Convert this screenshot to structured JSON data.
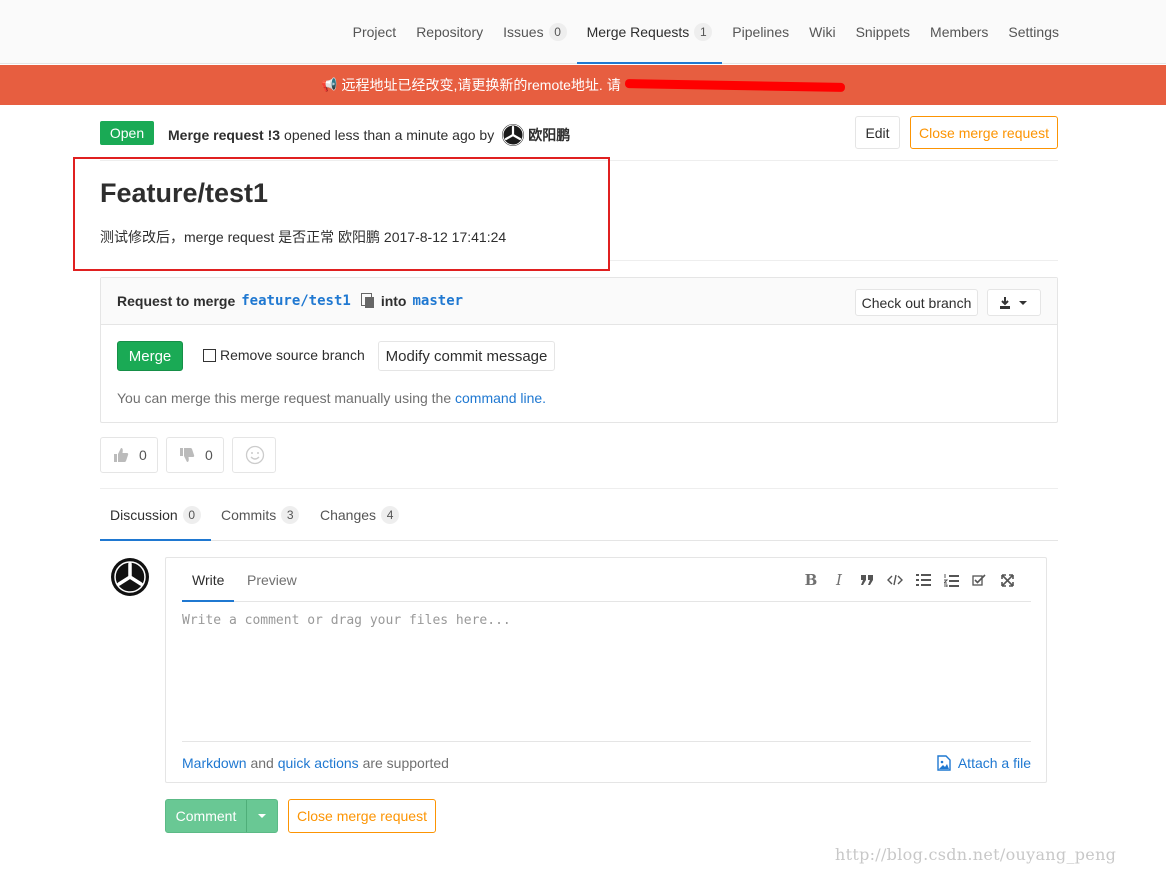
{
  "nav": {
    "tabs": [
      {
        "label": "Project"
      },
      {
        "label": "Repository"
      },
      {
        "label": "Issues",
        "count": "0"
      },
      {
        "label": "Merge Requests",
        "count": "1"
      },
      {
        "label": "Pipelines"
      },
      {
        "label": "Wiki"
      },
      {
        "label": "Snippets"
      },
      {
        "label": "Members"
      },
      {
        "label": "Settings"
      }
    ],
    "active": "Merge Requests"
  },
  "banner": {
    "icon": "megaphone-icon",
    "text": "远程地址已经改变,请更换新的remote地址. 请",
    "color": "#e75e40"
  },
  "mr": {
    "status": "Open",
    "ref": "Merge request !3",
    "opened": "opened less than a minute ago by",
    "author": "欧阳鹏",
    "edit_label": "Edit",
    "close_label": "Close merge request",
    "title": "Feature/test1",
    "description": "测试修改后，merge request 是否正常 欧阳鹏 2017-8-12 17:41:24"
  },
  "widget": {
    "request_label": "Request to merge",
    "source_branch": "feature/test1",
    "into_label": "into",
    "target_branch": "master",
    "checkout_label": "Check out branch",
    "merge_label": "Merge",
    "remove_source_label": "Remove source branch",
    "modify_commit_label": "Modify commit message",
    "manual_text": "You can merge this merge request manually using the",
    "manual_link": "command line."
  },
  "awards": {
    "thumbsup_count": "0",
    "thumbsdown_count": "0"
  },
  "tabs": [
    {
      "label": "Discussion",
      "count": "0"
    },
    {
      "label": "Commits",
      "count": "3"
    },
    {
      "label": "Changes",
      "count": "4"
    }
  ],
  "editor": {
    "write_label": "Write",
    "preview_label": "Preview",
    "toolbar": [
      "B",
      "I"
    ],
    "placeholder": "Write a comment or drag your files here...",
    "markdown_link": "Markdown",
    "and": "and",
    "quick_actions_link": "quick actions",
    "supported": "are supported",
    "attach_label": "Attach a file"
  },
  "actions": {
    "comment_label": "Comment",
    "close_label": "Close merge request"
  },
  "watermark": "http://blog.csdn.net/ouyang_peng",
  "colors": {
    "green": "#1aaa55",
    "link": "#1f78d1",
    "warning": "#fc9403",
    "annotation": "#e02020"
  }
}
